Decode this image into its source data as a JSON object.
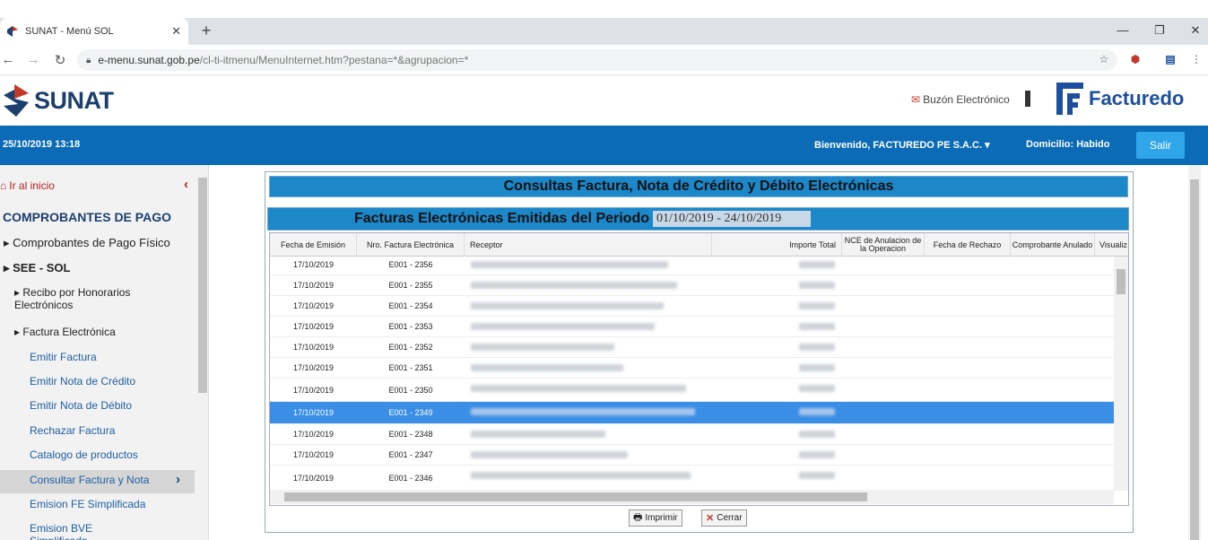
{
  "browser": {
    "tab_title": "SUNAT - Menú SOL",
    "url_host": "e-menu.sunat.gob.pe",
    "url_path": "/cl-ti-itmenu/MenuInternet.htm?pestana=*&agrupacion=*"
  },
  "header": {
    "logo_text": "SUNAT",
    "buzon_label": "Buzón Electrónico",
    "brand_text": "Facturedo"
  },
  "topbar": {
    "datetime": "25/10/2019 13:18",
    "welcome": "Bienvenido, FACTUREDO PE S.A.C.",
    "domicilio": "Domicilio: Habido",
    "logout": "Salir"
  },
  "sidebar": {
    "home": "Ir al inicio",
    "heading": "COMPROBANTES DE PAGO",
    "groups": [
      "Comprobantes de Pago Físico",
      "SEE - SOL"
    ],
    "sub_groups": [
      "Recibo por Honorarios Electrónicos",
      "Factura Electrónica"
    ],
    "links": [
      "Emitir Factura",
      "Emitir Nota de Crédito",
      "Emitir Nota de Débito",
      "Rechazar Factura",
      "Catalogo de productos",
      "Consultar Factura y Nota",
      "Emision FE Simplificada",
      "Emision BVE Simplificada"
    ],
    "active_link": "Consultar Factura y Nota"
  },
  "main": {
    "title": "Consultas Factura, Nota de Crédito y Débito Electrónicas",
    "subtitle": "Facturas Electrónicas Emitidas del Periodo",
    "period": "01/10/2019 - 24/10/2019",
    "columns": [
      "Fecha de Emisión",
      "Nro. Factura Electrónica",
      "Receptor",
      "Importe Total",
      "NCE de Anulacion de la Operacion",
      "Fecha de Rechazo",
      "Comprobante Anulado",
      "Visualiz"
    ],
    "rows": [
      {
        "fecha": "17/10/2019",
        "nro": "E001 - 2356"
      },
      {
        "fecha": "17/10/2019",
        "nro": "E001 - 2355"
      },
      {
        "fecha": "17/10/2019",
        "nro": "E001 - 2354"
      },
      {
        "fecha": "17/10/2019",
        "nro": "E001 - 2353"
      },
      {
        "fecha": "17/10/2019",
        "nro": "E001 - 2352"
      },
      {
        "fecha": "17/10/2019",
        "nro": "E001 - 2351"
      },
      {
        "fecha": "17/10/2019",
        "nro": "E001 - 2350"
      },
      {
        "fecha": "17/10/2019",
        "nro": "E001 - 2349"
      },
      {
        "fecha": "17/10/2019",
        "nro": "E001 - 2348"
      },
      {
        "fecha": "17/10/2019",
        "nro": "E001 - 2347"
      },
      {
        "fecha": "17/10/2019",
        "nro": "E001 - 2346"
      }
    ],
    "selected_row": "E001 - 2349",
    "print_label": "Imprimir",
    "close_label": "Cerrar"
  },
  "colors": {
    "bar_blue": "#0b6bb6",
    "title_blue": "#1c87c9",
    "selected_row": "#3a8ee6",
    "logout_button": "#2fa6e8"
  },
  "icons": [
    "favicon-icon",
    "close-tab-icon",
    "new-tab-icon",
    "minimize-icon",
    "maximize-icon",
    "window-close-icon",
    "back-icon",
    "forward-icon",
    "reload-icon",
    "lock-icon",
    "star-icon",
    "extension-icon",
    "menu-icon",
    "envelope-icon",
    "home-icon",
    "chevron-left-icon",
    "chevron-right-icon",
    "printer-icon",
    "x-icon"
  ]
}
